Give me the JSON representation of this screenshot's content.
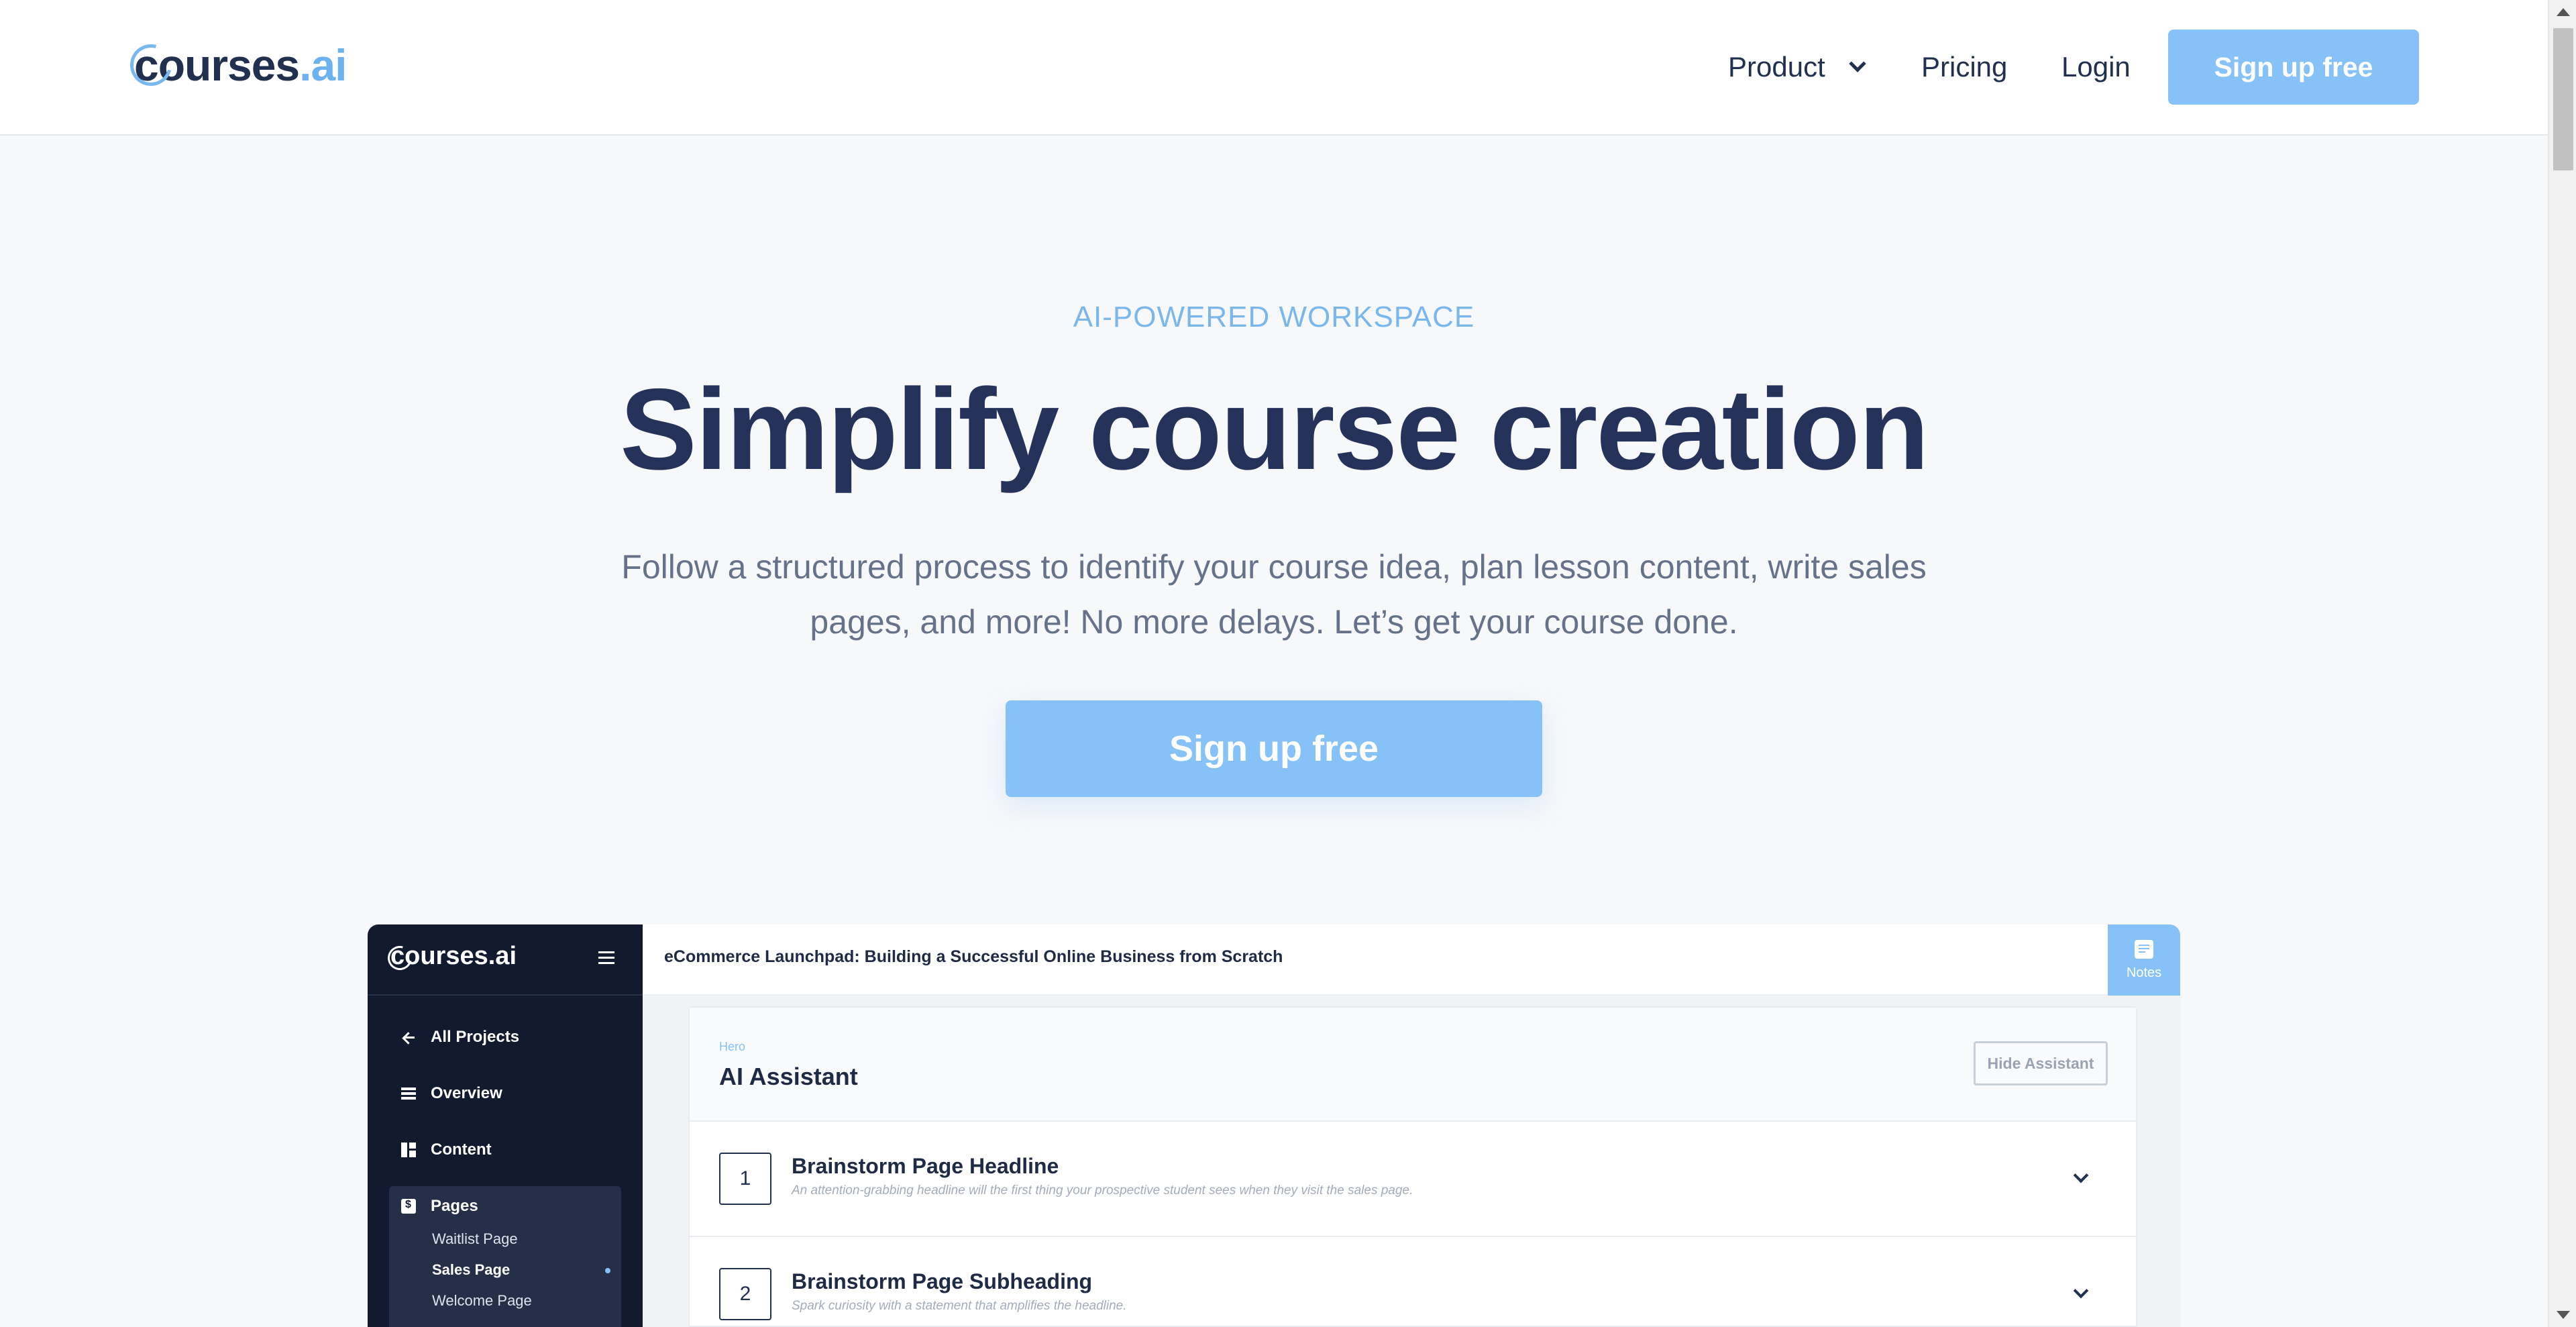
{
  "brand": {
    "logo_text": "courses",
    "logo_suffix": ".ai"
  },
  "nav": {
    "product_label": "Product",
    "pricing_label": "Pricing",
    "login_label": "Login",
    "signup_label": "Sign up free"
  },
  "hero": {
    "eyebrow": "AI-POWERED WORKSPACE",
    "headline": "Simplify course creation",
    "subline": "Follow a structured process to identify your course idea, plan lesson content, write sales pages, and more! No more delays. Let’s get your course done.",
    "cta_label": "Sign up free"
  },
  "mockup": {
    "logo_text": "courses",
    "logo_suffix": ".ai",
    "sidebar": {
      "items": [
        {
          "label": "All Projects",
          "icon": "arrow-left-icon"
        },
        {
          "label": "Overview",
          "icon": "list-icon"
        },
        {
          "label": "Content",
          "icon": "layout-icon"
        },
        {
          "label": "Pages",
          "icon": "page-dollar-icon"
        }
      ],
      "pages_subitems": [
        "Waitlist Page",
        "Sales Page",
        "Welcome Page"
      ],
      "active_subitem": "Sales Page"
    },
    "header": {
      "project_title": "eCommerce Launchpad: Building a Successful Online Business from Scratch",
      "notes_label": "Notes"
    },
    "assistant": {
      "section_label": "Hero",
      "title": "AI Assistant",
      "hide_label": "Hide Assistant",
      "steps": [
        {
          "number": "1",
          "title": "Brainstorm Page Headline",
          "description": "An attention-grabbing headline will the first thing your prospective student sees when they visit the sales page."
        },
        {
          "number": "2",
          "title": "Brainstorm Page Subheading",
          "description": "Spark curiosity with a statement that amplifies the headline."
        }
      ]
    }
  },
  "colors": {
    "accent": "#86c1f8",
    "navy": "#25325a",
    "sidebar_bg": "#111a2e",
    "page_bg": "#f7f8fa"
  }
}
